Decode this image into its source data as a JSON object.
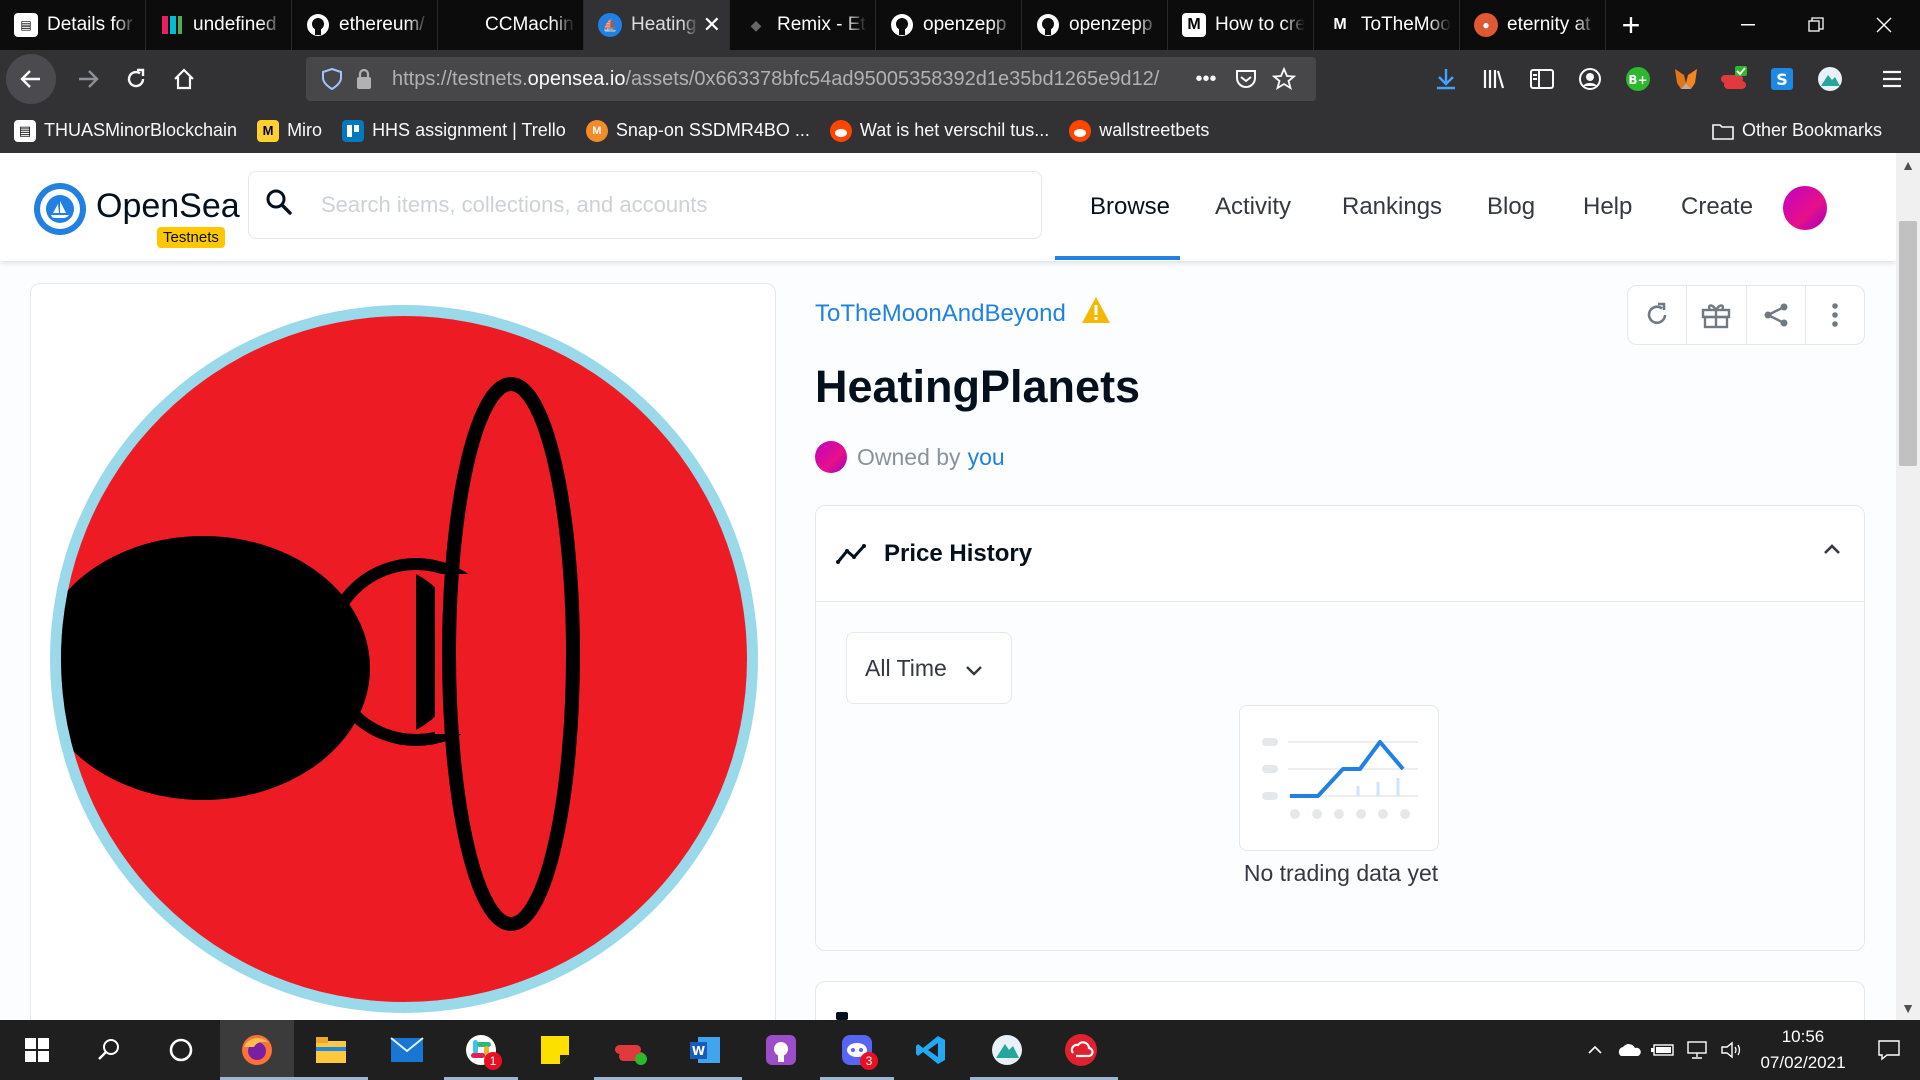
{
  "browser": {
    "tabs": [
      {
        "title": "Details for",
        "icon": "document-icon",
        "color": "#ffffff"
      },
      {
        "title": "undefined",
        "icon": "app-icon",
        "color": "#e91e63"
      },
      {
        "title": "ethereum/",
        "icon": "github-icon",
        "color": "#ffffff"
      },
      {
        "title": "CCMachine",
        "icon": "none",
        "color": ""
      },
      {
        "title": "Heating",
        "icon": "opensea-icon",
        "color": "#2081e2",
        "active": true
      },
      {
        "title": "Remix - Et",
        "icon": "remix-icon",
        "color": "#333333"
      },
      {
        "title": "openzepp",
        "icon": "github-icon",
        "color": "#ffffff"
      },
      {
        "title": "openzepp",
        "icon": "github-icon",
        "color": "#ffffff"
      },
      {
        "title": "How to cre",
        "icon": "medium-icon",
        "color": "#ffffff"
      },
      {
        "title": "ToTheMoo",
        "icon": "medium-icon",
        "color": "#ffffff"
      },
      {
        "title": "eternity at",
        "icon": "duckduckgo-icon",
        "color": "#de5833"
      }
    ],
    "url": {
      "prefix": "https://testnets.",
      "host": "opensea.io",
      "path": "/assets/0x663378bfc54ad95005358392d1e35bd1265e9d12/"
    },
    "bookmarks": [
      {
        "label": "THUASMinorBlockchain",
        "icon": "document-icon"
      },
      {
        "label": "Miro",
        "icon": "miro-icon"
      },
      {
        "label": "HHS assignment | Trello",
        "icon": "trello-icon"
      },
      {
        "label": "Snap-on SSDMR4BO ...",
        "icon": "snapon-icon"
      },
      {
        "label": "Wat is het verschil tus...",
        "icon": "reddit-icon"
      },
      {
        "label": "wallstreetbets",
        "icon": "reddit-icon"
      }
    ],
    "other_bookmarks": "Other Bookmarks"
  },
  "opensea": {
    "brand": "OpenSea",
    "badge": "Testnets",
    "search_placeholder": "Search items, collections, and accounts",
    "nav": [
      "Browse",
      "Activity",
      "Rankings",
      "Blog",
      "Help",
      "Create"
    ],
    "active_nav": "Browse"
  },
  "asset": {
    "collection": "ToTheMoonAndBeyond",
    "title": "HeatingPlanets",
    "owned_by_label": "Owned by",
    "owner": "you"
  },
  "price_history": {
    "title": "Price History",
    "period": "All Time",
    "empty_text": "No trading data yet"
  },
  "taskbar": {
    "time": "10:56",
    "date": "07/02/2021",
    "badges": {
      "slack": "1",
      "discord": "3"
    }
  },
  "colors": {
    "accent": "#2081e2",
    "planet_red": "#ed1c24",
    "planet_rim": "#99d9ea",
    "testnet_badge": "#ffc700"
  }
}
